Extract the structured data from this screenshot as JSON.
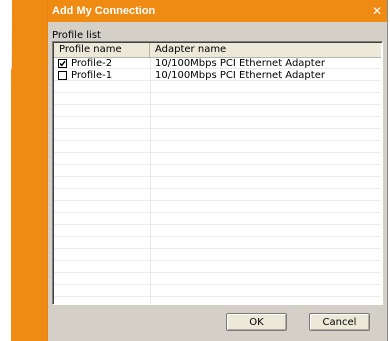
{
  "dialog": {
    "title": "Add My Connection",
    "close_glyph": "✕"
  },
  "list": {
    "label": "Profile list",
    "columns": [
      "Profile name",
      "Adapter name"
    ],
    "rows": [
      {
        "checked": true,
        "name": "Profile-2",
        "adapter": "10/100Mbps PCI Ethernet Adapter"
      },
      {
        "checked": false,
        "name": "Profile-1",
        "adapter": "10/100Mbps PCI Ethernet Adapter"
      }
    ]
  },
  "buttons": {
    "ok": "OK",
    "cancel": "Cancel"
  },
  "colors": {
    "accent": "#ef8a12",
    "dialog_bg": "#d4d0c8"
  },
  "icons": {
    "close": "close-icon",
    "checkbox_checked": "checkbox-checked-icon",
    "checkbox_unchecked": "checkbox-unchecked-icon"
  }
}
